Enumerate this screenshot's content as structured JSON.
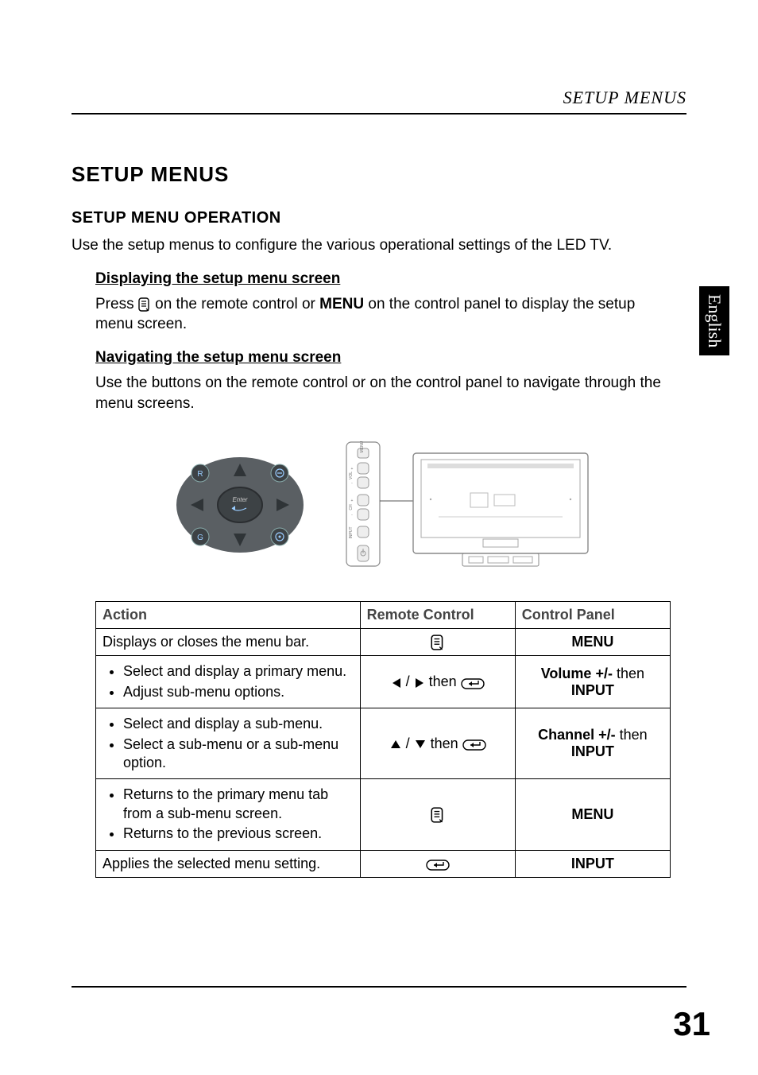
{
  "header": {
    "running_title": "SETUP MENUS"
  },
  "side_tab": "English",
  "section": {
    "title": "SETUP MENUS",
    "subtitle": "SETUP MENU OPERATION",
    "intro": "Use the setup menus to configure the various operational settings of the LED TV.",
    "step1_heading": "Displaying the setup menu screen",
    "step1_pre": "Press ",
    "step1_mid": " on the remote control or ",
    "step1_menu": "MENU",
    "step1_post": " on the control panel to display the setup menu screen.",
    "step2_heading": "Navigating the setup menu screen",
    "step2_text": "Use the buttons on the remote control or on the control panel to navigate through the menu screens."
  },
  "table": {
    "headers": {
      "action": "Action",
      "remote": "Remote Control",
      "panel": "Control Panel"
    },
    "rows": [
      {
        "action_plain": "Displays or closes the menu bar.",
        "remote_icon": "menu-icon",
        "panel": "MENU"
      },
      {
        "action_items": [
          "Select and display a primary menu.",
          "Adjust sub-menu options."
        ],
        "remote_lr_then_enter": true,
        "panel_html": "<span class='cp-strong'>Volume +/-</span> then <span class='cp-strong'>INPUT</span>"
      },
      {
        "action_items": [
          "Select and display a sub-menu.",
          "Select a sub-menu or a sub-menu option."
        ],
        "remote_ud_then_enter": true,
        "panel_html": "<span class='cp-strong'>Channel +/-</span> then <span class='cp-strong'>INPUT</span>"
      },
      {
        "action_items": [
          "Returns to the primary menu tab from a sub-menu screen.",
          "Returns to the previous screen."
        ],
        "remote_icon": "menu-icon",
        "panel": "MENU"
      },
      {
        "action_plain": "Applies the selected menu setting.",
        "remote_icon": "enter-icon",
        "panel": "INPUT"
      }
    ],
    "then_word": "then"
  },
  "page_number": "31",
  "panel_labels": [
    "MENU",
    "VOL",
    "CH",
    "INPUT"
  ]
}
